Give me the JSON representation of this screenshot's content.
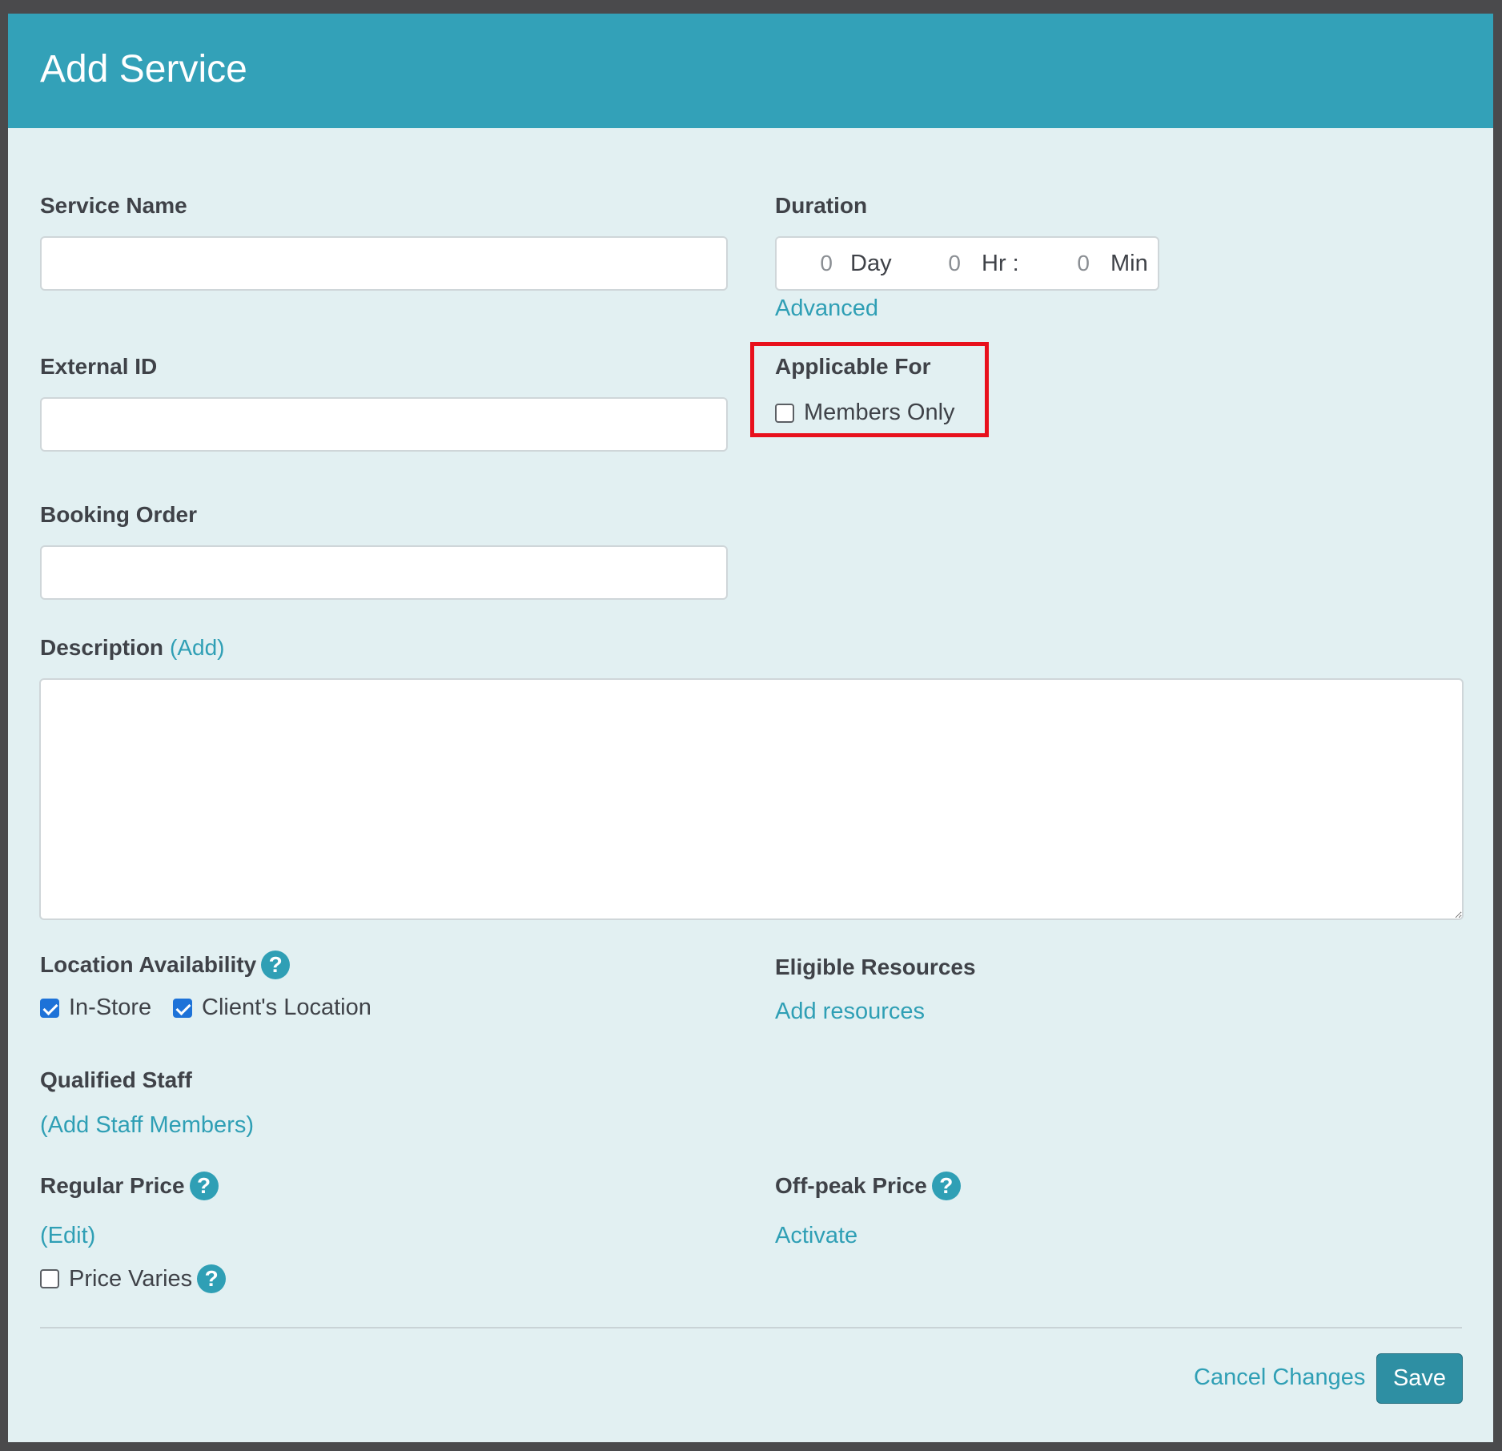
{
  "dialog": {
    "title": "Add Service"
  },
  "form": {
    "service_name": {
      "label": "Service Name",
      "value": ""
    },
    "external_id": {
      "label": "External ID",
      "value": ""
    },
    "booking_order": {
      "label": "Booking Order",
      "value": ""
    },
    "duration": {
      "label": "Duration",
      "day_value": "0",
      "day_unit": "Day",
      "hr_value": "0",
      "hr_unit": "Hr :",
      "min_value": "0",
      "min_unit": "Min",
      "advanced_link": "Advanced"
    },
    "applicable_for": {
      "label": "Applicable For",
      "members_only_label": "Members Only",
      "members_only_checked": false,
      "highlight_color": "#e8101c"
    },
    "description": {
      "label": "Description",
      "add_link": "(Add)",
      "value": ""
    },
    "location_availability": {
      "label": "Location Availability",
      "help": "?",
      "options": [
        {
          "label": "In-Store",
          "checked": true
        },
        {
          "label": "Client's Location",
          "checked": true
        }
      ]
    },
    "eligible_resources": {
      "label": "Eligible Resources",
      "add_link": "Add resources"
    },
    "qualified_staff": {
      "label": "Qualified Staff",
      "add_link": "(Add Staff Members)"
    },
    "regular_price": {
      "label": "Regular Price",
      "help": "?",
      "edit_link": "(Edit)",
      "price_varies_label": "Price Varies",
      "price_varies_checked": false
    },
    "offpeak_price": {
      "label": "Off-peak Price",
      "help": "?",
      "activate_link": "Activate"
    }
  },
  "footer": {
    "cancel_label": "Cancel Changes",
    "save_label": "Save"
  },
  "colors": {
    "header": "#33a1b8",
    "background": "#e2f0f2",
    "link": "#2f9fb5",
    "button": "#2e8fa3",
    "checkbox_checked": "#1d72d8"
  }
}
